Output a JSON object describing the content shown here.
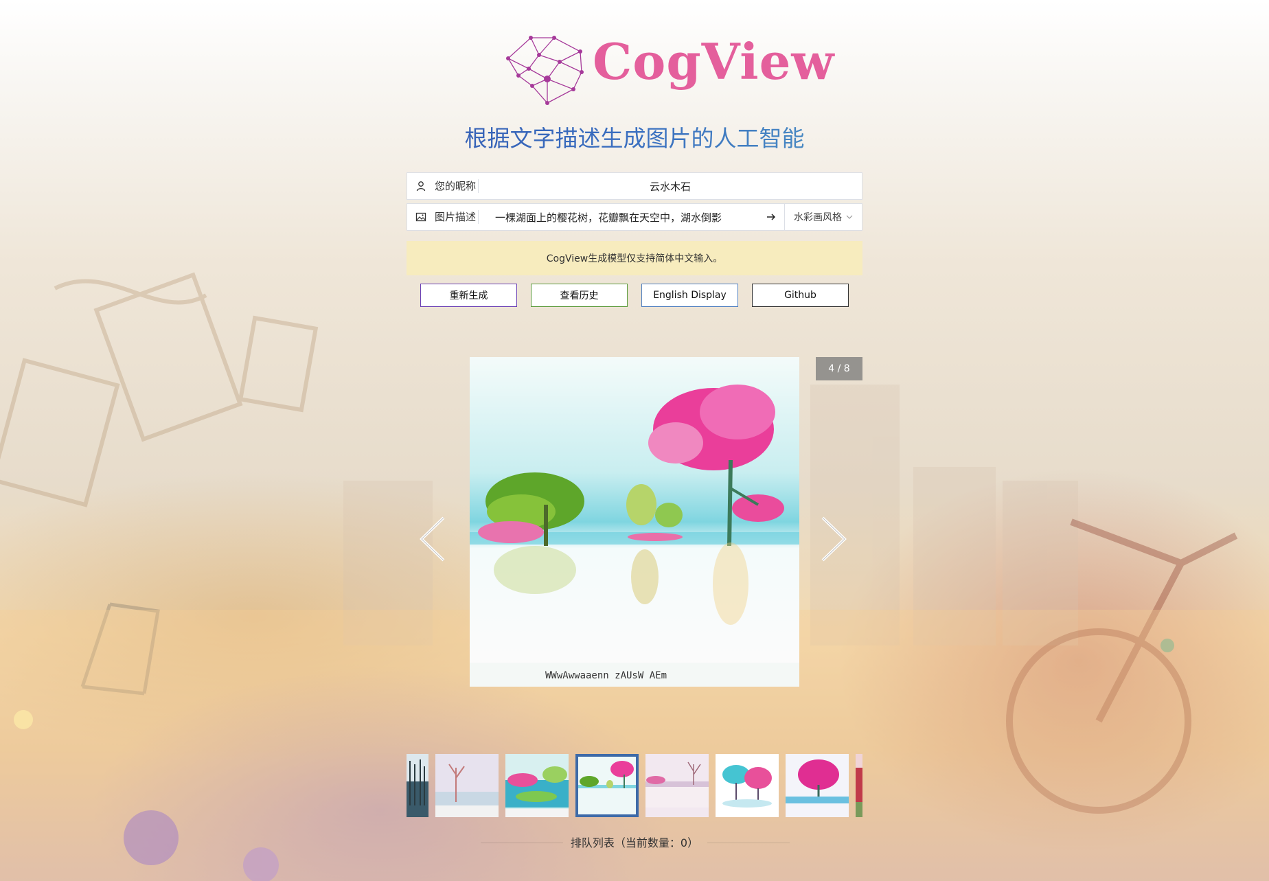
{
  "app": {
    "name": "CogView"
  },
  "tagline": "根据文字描述生成图片的人工智能",
  "nickname": {
    "label": "您的昵称",
    "value": "云水木石",
    "icon": "user-icon"
  },
  "description": {
    "label": "图片描述",
    "value": "一棵湖面上的樱花树，花瓣飘在天空中，湖水倒影",
    "icon": "image-icon",
    "submit_icon": "arrow-right-icon",
    "style_selected": "水彩画风格"
  },
  "notice": "CogView生成模型仅支持简体中文输入。",
  "buttons": {
    "regenerate": "重新生成",
    "history": "查看历史",
    "english": "English Display",
    "github": "Github"
  },
  "gallery": {
    "counter": "4 / 8",
    "current": 4,
    "total": 8,
    "watermark": "WWwAwwaaenn  zAUsW AEm"
  },
  "queue": {
    "text": "排队列表（当前数量：0）"
  },
  "colors": {
    "brand": "#e45f9c",
    "notice_bg": "#f7ecbe",
    "active_thumb": "#3d6aa8"
  }
}
